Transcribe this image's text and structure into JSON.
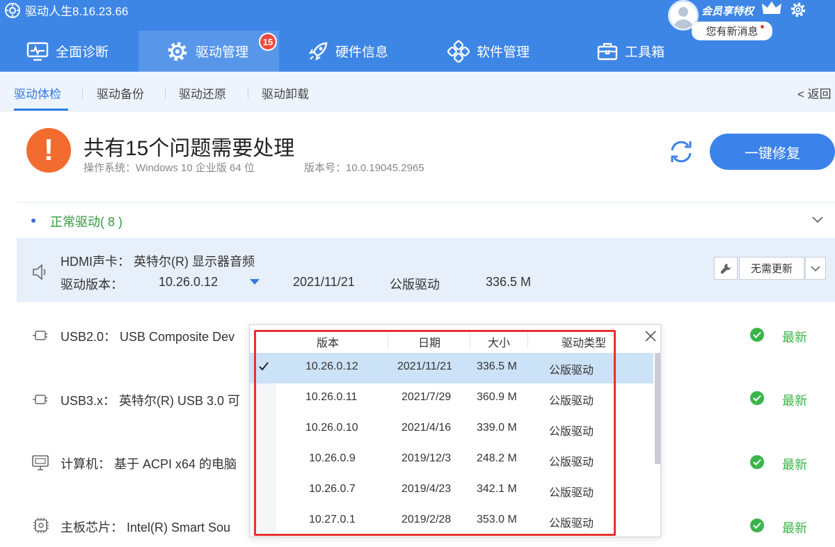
{
  "app": {
    "title": "驱动人生8.16.23.66"
  },
  "nav": {
    "tabs": [
      {
        "label": "全面诊断",
        "icon": "monitor-icon"
      },
      {
        "label": "驱动管理",
        "icon": "gear-icon",
        "badge": "15"
      },
      {
        "label": "硬件信息",
        "icon": "rocket-icon"
      },
      {
        "label": "软件管理",
        "icon": "apps-icon"
      },
      {
        "label": "工具箱",
        "icon": "toolbox-icon"
      }
    ],
    "active_index": 1
  },
  "member": {
    "label": "会员享特权",
    "message": "您有新消息"
  },
  "subtabs": [
    "驱动体检",
    "驱动备份",
    "驱动还原",
    "驱动卸载"
  ],
  "back_label": "< 返回",
  "summary": {
    "title": "共有15个问题需要处理",
    "os": "操作系统：Windows 10 企业版 64 位",
    "version": "版本号：10.0.19045.2965",
    "fix_button": "一键修复"
  },
  "section": {
    "title": "正常驱动( 8 )"
  },
  "selected_device": {
    "name": "HDMI声卡：  英特尔(R) 显示器音频",
    "version_label": "驱动版本：",
    "version": "10.26.0.12",
    "date": "2021/11/21",
    "type": "公版驱动",
    "size": "336.5 M",
    "no_update_label": "无需更新"
  },
  "devices": [
    {
      "name": "USB2.0：  USB Composite Dev",
      "status": "最新"
    },
    {
      "name": "USB3.x：  英特尔(R) USB 3.0 可",
      "status": "最新"
    },
    {
      "name": "计算机：  基于 ACPI x64 的电脑",
      "status": "最新"
    },
    {
      "name": "主板芯片：  Intel(R) Smart Sou",
      "status": "最新"
    }
  ],
  "popup": {
    "headers": [
      "版本",
      "日期",
      "大小",
      "驱动类型"
    ],
    "rows": [
      {
        "version": "10.26.0.12",
        "date": "2021/11/21",
        "size": "336.5 M",
        "type": "公版驱动",
        "current": true
      },
      {
        "version": "10.26.0.11",
        "date": "2021/7/29",
        "size": "360.9 M",
        "type": "公版驱动",
        "current": false
      },
      {
        "version": "10.26.0.10",
        "date": "2021/4/16",
        "size": "339.0 M",
        "type": "公版驱动",
        "current": false
      },
      {
        "version": "10.26.0.9",
        "date": "2019/12/3",
        "size": "248.2 M",
        "type": "公版驱动",
        "current": false
      },
      {
        "version": "10.26.0.7",
        "date": "2019/4/23",
        "size": "342.1 M",
        "type": "公版驱动",
        "current": false
      },
      {
        "version": "10.27.0.1",
        "date": "2019/2/28",
        "size": "353.0 M",
        "type": "公版驱动",
        "current": false
      }
    ]
  },
  "colors": {
    "primary": "#3d86e6",
    "success": "#3bb54a",
    "alert": "#f26b2f",
    "highlight": "#e8312f"
  }
}
